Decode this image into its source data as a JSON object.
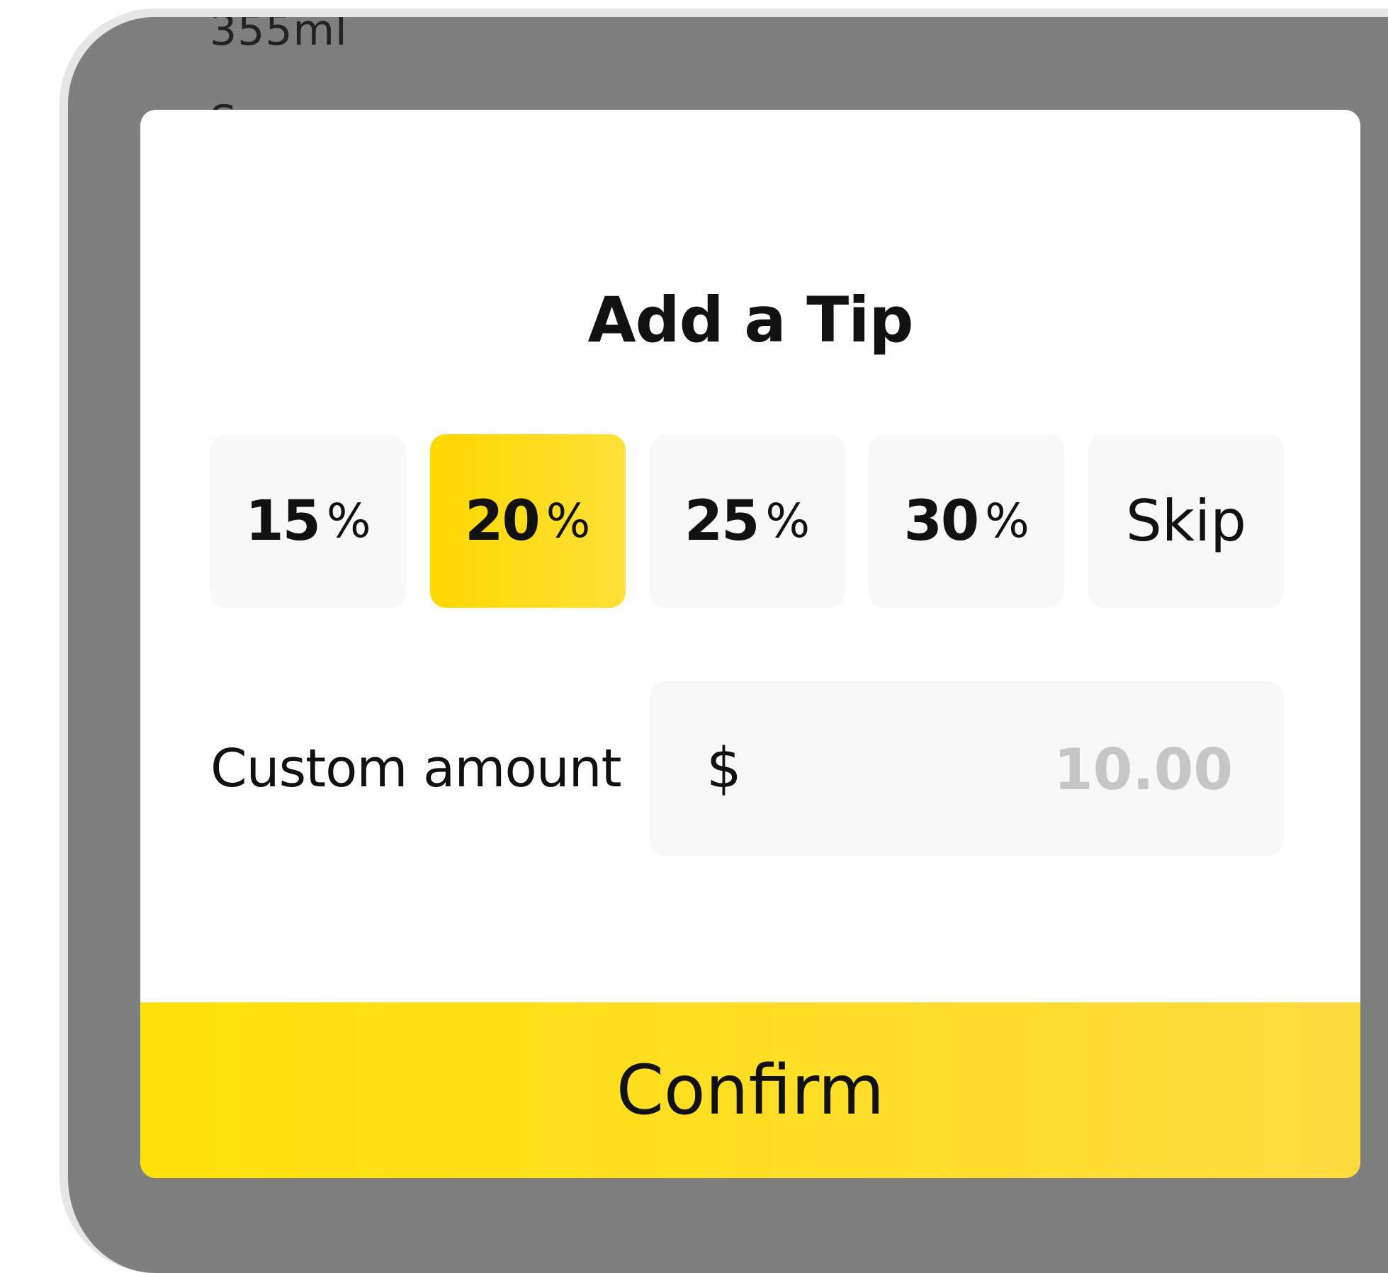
{
  "background": {
    "lines": [
      "355ml",
      "Syrup"
    ]
  },
  "modal": {
    "title": "Add a Tip",
    "tip_options": [
      {
        "number": "15",
        "suffix": "%"
      },
      {
        "number": "20",
        "suffix": "%"
      },
      {
        "number": "25",
        "suffix": "%"
      },
      {
        "number": "30",
        "suffix": "%"
      },
      {
        "label": "Skip"
      }
    ],
    "selected_tip": "20%",
    "custom": {
      "label": "Custom amount",
      "currency": "$",
      "value": "",
      "placeholder": "10.00"
    },
    "confirm_label": "Confirm"
  },
  "colors": {
    "accent": "#fed800",
    "overlay": "#7f7f7f",
    "option_bg": "#f8f8f8",
    "placeholder": "#c6c6c6"
  }
}
